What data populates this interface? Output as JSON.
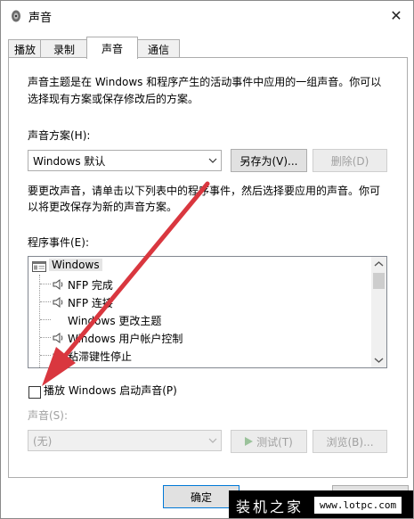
{
  "window": {
    "title": "声音"
  },
  "tabs": [
    {
      "label": "播放"
    },
    {
      "label": "录制"
    },
    {
      "label": "声音"
    },
    {
      "label": "通信"
    }
  ],
  "intro": {
    "line1": "声音主题是在 Windows 和程序产生的活动事件中应用的一组声音。你可以",
    "line2": "选择现有方案或保存修改后的方案。"
  },
  "scheme": {
    "label": "声音方案(H):",
    "selected": "Windows 默认",
    "save_as_label": "另存为(V)...",
    "delete_label": "删除(D)"
  },
  "instructions": {
    "line1": "要更改声音，请单击以下列表中的程序事件，然后选择要应用的声音。你可",
    "line2": "以将更改保存为新的声音方案。"
  },
  "events": {
    "label": "程序事件(E):",
    "items": [
      {
        "label": "Windows",
        "icon": "app-window-icon",
        "level": 0,
        "has_sound": false
      },
      {
        "label": "NFP 完成",
        "icon": "speaker-icon",
        "level": 1,
        "has_sound": true
      },
      {
        "label": "NFP 连接",
        "icon": "speaker-icon",
        "level": 1,
        "has_sound": true
      },
      {
        "label": "Windows 更改主题",
        "icon": "",
        "level": 1,
        "has_sound": false
      },
      {
        "label": "Windows 用户帐户控制",
        "icon": "speaker-icon",
        "level": 1,
        "has_sound": true
      },
      {
        "label": "粘滞键性停止",
        "icon": "speaker-icon",
        "level": 1,
        "has_sound": true
      }
    ]
  },
  "startup_sound": {
    "label": "播放 Windows 启动声音(P)",
    "checked": false
  },
  "sound": {
    "label": "声音(S):",
    "selected": "(无)",
    "test_label": "测试(T)",
    "browse_label": "浏览(B)..."
  },
  "footer": {
    "ok_label": "确定"
  },
  "watermark": {
    "text": "装机之家",
    "url": "www.lotpc.com"
  },
  "colors": {
    "annotation_arrow": "#d9373f",
    "selection": "#e5e5e5"
  }
}
